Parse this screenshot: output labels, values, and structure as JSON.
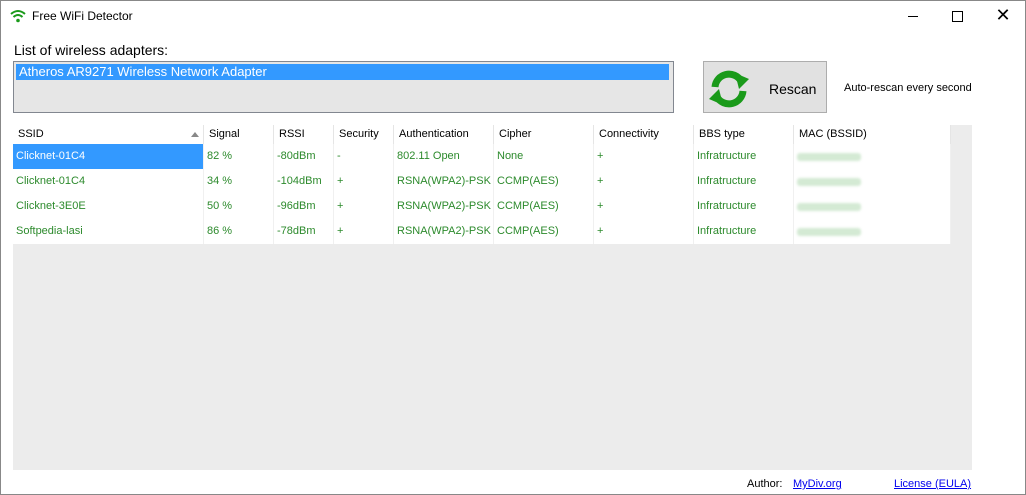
{
  "window": {
    "title": "Free WiFi Detector",
    "app_icon": "wifi-icon",
    "controls": {
      "minimize": "minimize-icon",
      "maximize": "maximize-icon",
      "close": "close-icon"
    }
  },
  "adapters": {
    "label": "List of wireless adapters:",
    "items": [
      "Atheros AR9271 Wireless Network Adapter"
    ]
  },
  "rescan": {
    "label": "Rescan",
    "icon": "refresh-icon",
    "icon_color": "#1a9a1a"
  },
  "auto_rescan_label": "Auto-rescan every second",
  "table": {
    "columns": [
      "SSID",
      "Signal",
      "RSSI",
      "Security",
      "Authentication",
      "Cipher",
      "Connectivity",
      "BBS type",
      "MAC (BSSID)"
    ],
    "rows": [
      [
        "Clicknet-01C4",
        "82 %",
        "-80dBm",
        "-",
        "802.11 Open",
        "None",
        "+",
        "Infratructure"
      ],
      [
        "Clicknet-01C4",
        "34 %",
        "-104dBm",
        "+",
        "RSNA(WPA2)-PSK",
        "CCMP(AES)",
        "+",
        "Infratructure"
      ],
      [
        "Clicknet-3E0E",
        "50 %",
        "-96dBm",
        "+",
        "RSNA(WPA2)-PSK",
        "CCMP(AES)",
        "+",
        "Infratructure"
      ],
      [
        "Softpedia-lasi",
        "86 %",
        "-78dBm",
        "+",
        "RSNA(WPA2)-PSK",
        "CCMP(AES)",
        "+",
        "Infratructure"
      ]
    ],
    "text_color": "#2c8a2c",
    "selection_color": "#3399ff"
  },
  "footer": {
    "author_label": "Author:",
    "author_link": "MyDiv.org",
    "license_link": "License (EULA)"
  }
}
